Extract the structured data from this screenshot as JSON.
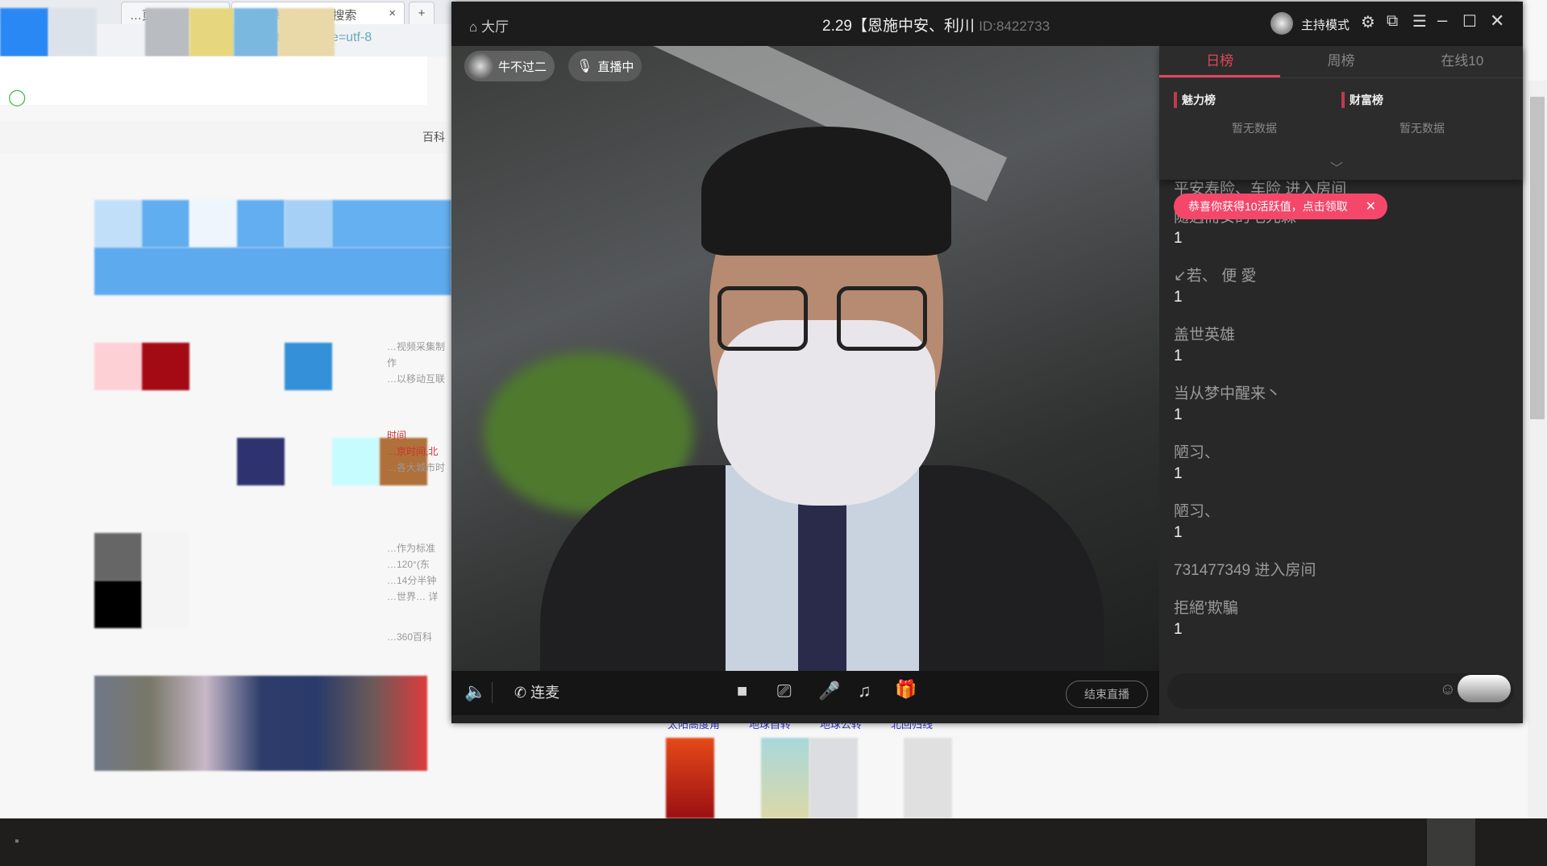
{
  "browser": {
    "tabs": [
      {
        "label": "…页_整…"
      },
      {
        "label": "北京时间_360搜索"
      }
    ],
    "new_tab": "+",
    "address": "https://… ?ie=utf-8",
    "nav_item": "百科",
    "snippets": [
      "…视频采集制作",
      "…以移动互联",
      "时间",
      "…京时间,北",
      "…各大城市时",
      "…作为标准",
      "…120°(东",
      "…14分半钟",
      "…世界… 详",
      "…360百科"
    ],
    "links": [
      "太阳高度角",
      "地球自转",
      "地球公转",
      "北回归线"
    ]
  },
  "live": {
    "home_label": "大厅",
    "title": "2.29【恩施中安、利川",
    "room_id": "ID:8422733",
    "host_mode": "主持模式",
    "host_name": "牛不过二",
    "live_status": "直播中",
    "toolbar": {
      "link_mic": "连麦",
      "end_live": "结束直播"
    },
    "tabs": [
      {
        "label": "日榜",
        "active": true
      },
      {
        "label": "周榜",
        "active": false
      },
      {
        "label": "在线10",
        "active": false
      }
    ],
    "ranks": [
      {
        "title": "魅力榜",
        "empty": "暂无数据"
      },
      {
        "title": "财富榜",
        "empty": "暂无数据"
      }
    ],
    "toast": "恭喜你获得10活跃值，点击领取",
    "chat_top": "平安寿险、车险 进入房间",
    "chat": [
      {
        "name": "随遇而安的毛先森",
        "value": "1"
      },
      {
        "name": "↙若、 便 愛",
        "value": "1"
      },
      {
        "name": "盖世英雄",
        "value": "1"
      },
      {
        "name": "当从梦中醒来丶",
        "value": "1"
      },
      {
        "name": "陋习、",
        "value": "1"
      },
      {
        "name": "陋习、",
        "value": "1"
      },
      {
        "name": "731477349 进入房间",
        "value": null
      },
      {
        "name": "拒絕'欺騙",
        "value": "1"
      }
    ],
    "accent": "#e0455e"
  }
}
